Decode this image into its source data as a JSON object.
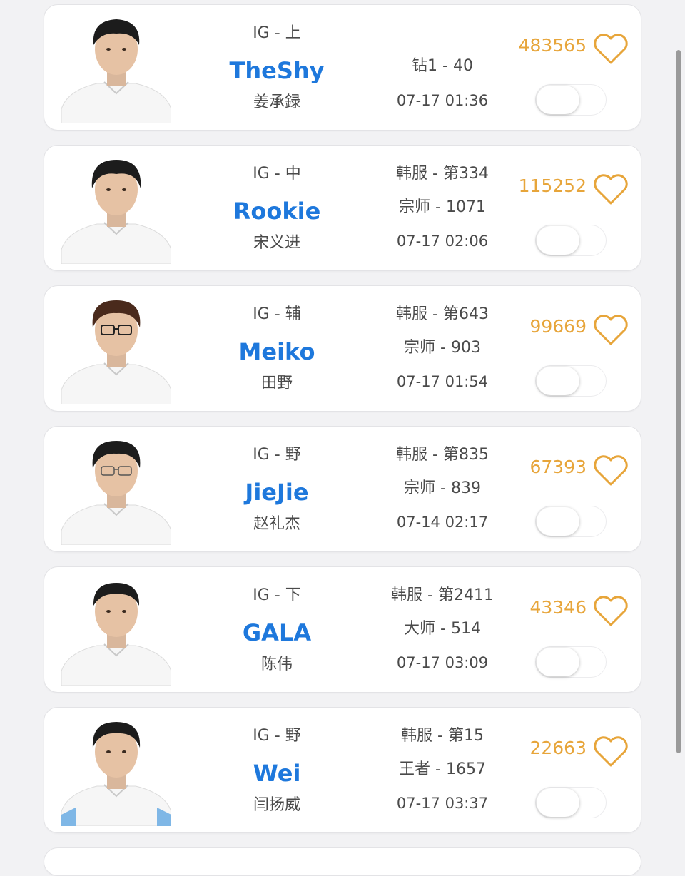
{
  "accent_colors": {
    "name": "#1e78dc",
    "likes": "#e7a53a"
  },
  "players": [
    {
      "team_pos": "IG - 上",
      "handle": "TheShy",
      "real_name": "姜承録",
      "rank_line1": "钻1 - 40",
      "rank_line2": "",
      "time": "07-17 01:36",
      "likes": "483565",
      "icon": "heart-outline-icon",
      "toggle_on": false
    },
    {
      "team_pos": "IG - 中",
      "handle": "Rookie",
      "real_name": "宋义进",
      "rank_line1": "韩服 - 第334",
      "rank_line2": "宗师 - 1071",
      "time": "07-17 02:06",
      "likes": "115252",
      "icon": "heart-outline-icon",
      "toggle_on": false
    },
    {
      "team_pos": "IG - 辅",
      "handle": "Meiko",
      "real_name": "田野",
      "rank_line1": "韩服 - 第643",
      "rank_line2": "宗师 - 903",
      "time": "07-17 01:54",
      "likes": "99669",
      "icon": "heart-outline-icon",
      "toggle_on": false
    },
    {
      "team_pos": "IG - 野",
      "handle": "JieJie",
      "real_name": "赵礼杰",
      "rank_line1": "韩服 - 第835",
      "rank_line2": "宗师 - 839",
      "time": "07-14 02:17",
      "likes": "67393",
      "icon": "heart-outline-icon",
      "toggle_on": false
    },
    {
      "team_pos": "IG - 下",
      "handle": "GALA",
      "real_name": "陈伟",
      "rank_line1": "韩服 - 第2411",
      "rank_line2": "大师 - 514",
      "time": "07-17 03:09",
      "likes": "43346",
      "icon": "heart-outline-icon",
      "toggle_on": false
    },
    {
      "team_pos": "IG - 野",
      "handle": "Wei",
      "real_name": "闫扬威",
      "rank_line1": "韩服 - 第15",
      "rank_line2": "王者 - 1657",
      "time": "07-17 03:37",
      "likes": "22663",
      "icon": "heart-outline-icon",
      "toggle_on": false
    }
  ]
}
